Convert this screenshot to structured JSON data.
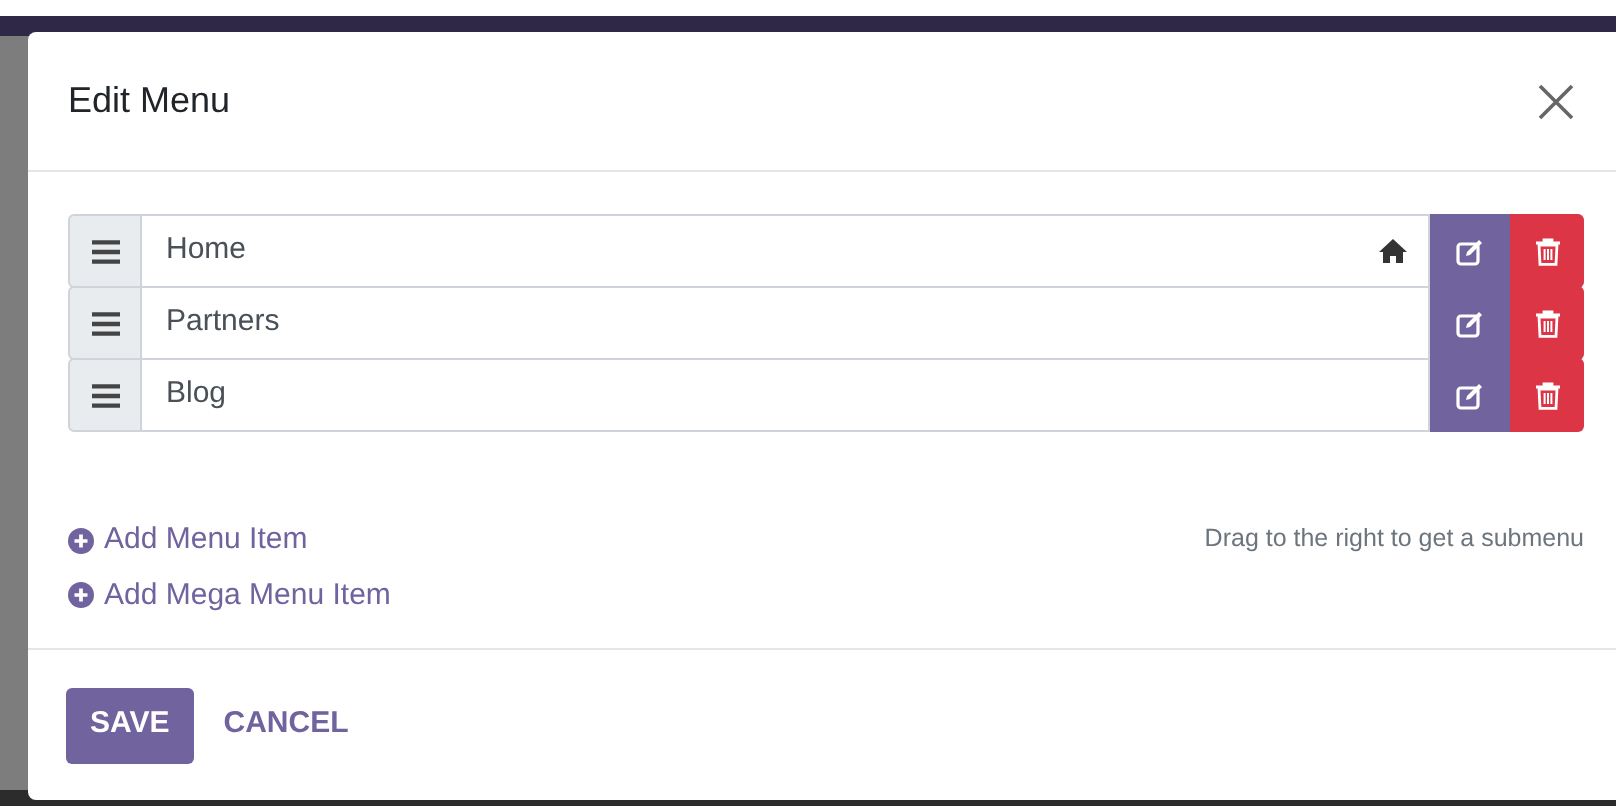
{
  "dialog": {
    "title": "Edit Menu"
  },
  "menu_items": [
    {
      "label": "Home",
      "is_homepage": true
    },
    {
      "label": "Partners",
      "is_homepage": false
    },
    {
      "label": "Blog",
      "is_homepage": false
    }
  ],
  "add_links": [
    "Add Menu Item",
    "Add Mega Menu Item"
  ],
  "hint": "Drag to the right to get a submenu",
  "buttons": [
    {
      "label": "SAVE",
      "kind": "primary"
    },
    {
      "label": "CANCEL",
      "kind": "link"
    }
  ]
}
